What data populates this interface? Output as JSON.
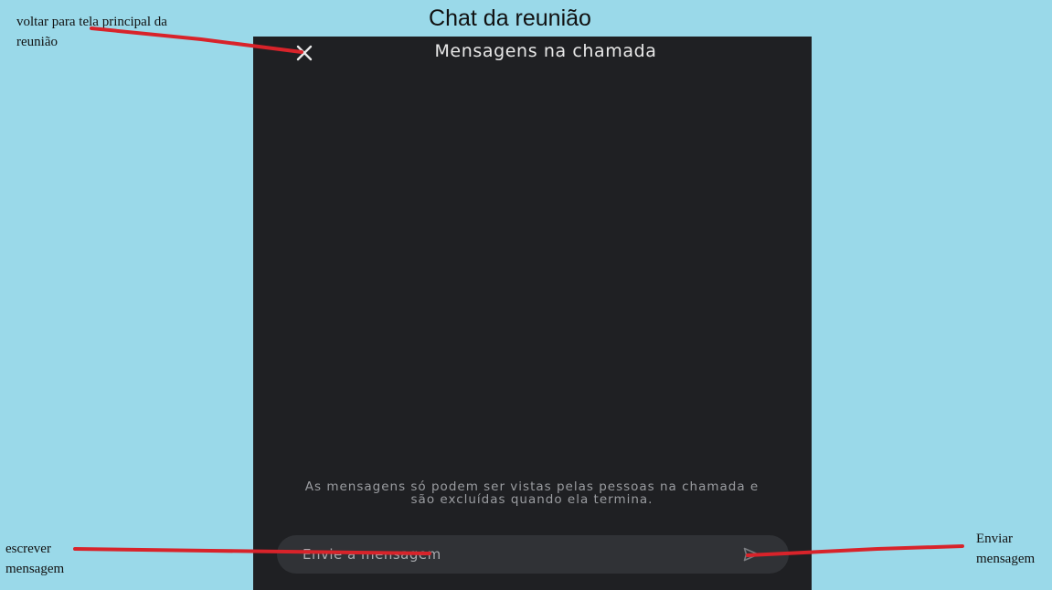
{
  "page": {
    "title": "Chat da reunião"
  },
  "annotations": {
    "back": "voltar para tela principal da reunião",
    "write": "escrever mensagem",
    "send": "Enviar mensagem"
  },
  "chat": {
    "header_title": "Mensagens na chamada",
    "close_icon": "close-icon",
    "disclaimer": "As mensagens só podem ser vistas pelas pessoas na chamada e são excluídas quando ela termina.",
    "input_placeholder": "Envie a mensagem",
    "send_icon": "send-icon"
  },
  "colors": {
    "background": "#9ad9e9",
    "phone_background": "#1f2023",
    "composer_background": "#303236",
    "annotation_arrow": "#d8232a"
  }
}
